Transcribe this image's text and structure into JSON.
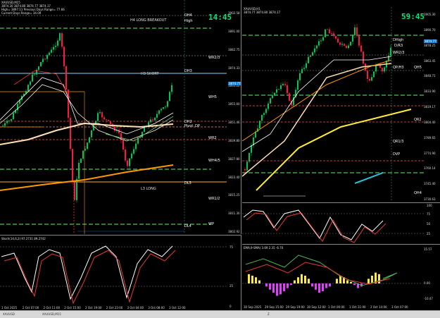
{
  "left": {
    "header": {
      "symbol": "XAUUSD,M15",
      "ohlc": "3874.20 3874.80 3874.77 3874.17",
      "line3": "High= 3897.11   Previous Days Range= 77.66",
      "line4": "Current Days Range= 34.09"
    },
    "clock": "14:45",
    "levels": {
      "h4_long": "H4 LONG BREAKOUT",
      "h3_short": "H3 SHORT",
      "l3_long": "L3 LONG"
    },
    "tags": [
      "DH4",
      "High",
      "WR2/3",
      "DH3",
      "WH5",
      "DH2",
      "Pivot",
      "DP",
      "WR2",
      "WH4/5",
      "DL3",
      "WR1/2",
      "DL4",
      "WP"
    ],
    "price_axis": [
      "3902.58",
      "3891.00",
      "3882.75",
      "3874.33",
      "3863.20",
      "3855.60",
      "3851.46",
      "3839.80",
      "3827.80",
      "3823.40",
      "3815.25",
      "3811.30",
      "3802.92"
    ],
    "current_price": "3874.77",
    "stoch_label": "Stoch(14,6,2) 97.2731 89.2742",
    "stoch_levels": [
      "75",
      "25",
      "0"
    ],
    "time_axis": [
      "1 Oct 2025",
      "2 Oct 07:00",
      "2 Oct 11:00",
      "2 Oct 15:00",
      "2 Oct 19:00",
      "2 Oct 23:00",
      "3 Oct 04:00",
      "3 Oct 08:00",
      "3 Oct 12:00"
    ]
  },
  "right": {
    "header": {
      "line1": "XAUUSD,H1",
      "ohlc": "3874.77 3874.80 3874.17"
    },
    "clock": "59:45",
    "tags": [
      "DHigh",
      "D/R3",
      "WR2/3",
      "QP/H3",
      "QH5",
      "QR2",
      "QR1/3",
      "DVP",
      "QH4"
    ],
    "price_axis": [
      "3905.30",
      "3890.70",
      "3878.25",
      "3863.45",
      "3848.71",
      "3833.90",
      "3819.17",
      "3804.40",
      "3789.65",
      "3774.90",
      "3760.14",
      "3745.40",
      "3730.63"
    ],
    "current_price": "3874.77",
    "stoch_levels": [
      "100",
      "75",
      "50",
      "25"
    ],
    "osc_label": "EMA,9-SMA) 3.69 2.35 -6.70",
    "osc_levels": [
      "15.57",
      "0.00",
      "-10.47"
    ],
    "time_axis": [
      "30 Sep 2025",
      "29 Sep 15:00",
      "29 Sep 19:00",
      "30 Sep 12:00",
      "1 Oct 00:00",
      "1 Oct 21:00",
      "2 Oct 14:00",
      "3 Oct 07:00"
    ]
  },
  "taskbar": {
    "items": [
      "XAUUSD",
      "XAUUSD,M15",
      "Z"
    ]
  }
}
